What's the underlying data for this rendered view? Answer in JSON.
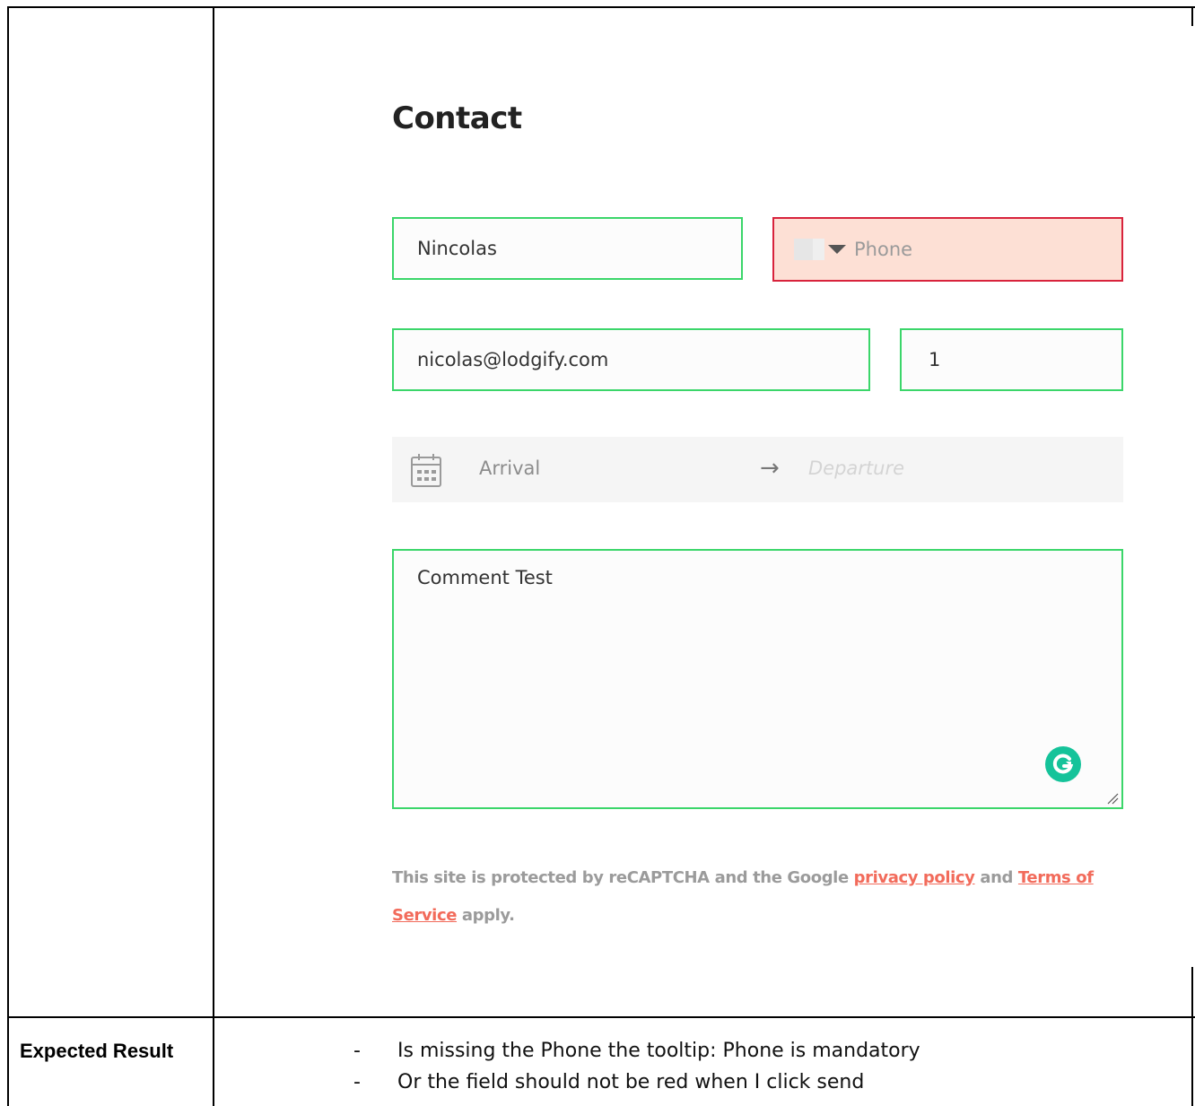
{
  "contact": {
    "title": "Contact",
    "name_value": "Nincolas",
    "phone_placeholder": "Phone",
    "email_value": "nicolas@lodgify.com",
    "guests_value": "1",
    "arrival_placeholder": "Arrival",
    "departure_placeholder": "Departure",
    "comment_value": "Comment Test",
    "recaptcha": {
      "prefix": "This site is protected by reCAPTCHA and the Google ",
      "privacy_link": "privacy policy",
      "middle": " and ",
      "terms_link_line1": "Terms of",
      "terms_link_line2": "Service",
      "suffix": " apply."
    }
  },
  "expected": {
    "label": "Expected Result",
    "items": [
      {
        "dash": "-",
        "text": "Is missing the Phone the tooltip: Phone is mandatory"
      },
      {
        "dash": "-",
        "text": "Or the field should not be red when I click send"
      }
    ]
  },
  "colors": {
    "valid_border": "#3bd66a",
    "error_border": "#d8233c",
    "error_background": "#fde0d5",
    "link": "#f26b5b"
  }
}
